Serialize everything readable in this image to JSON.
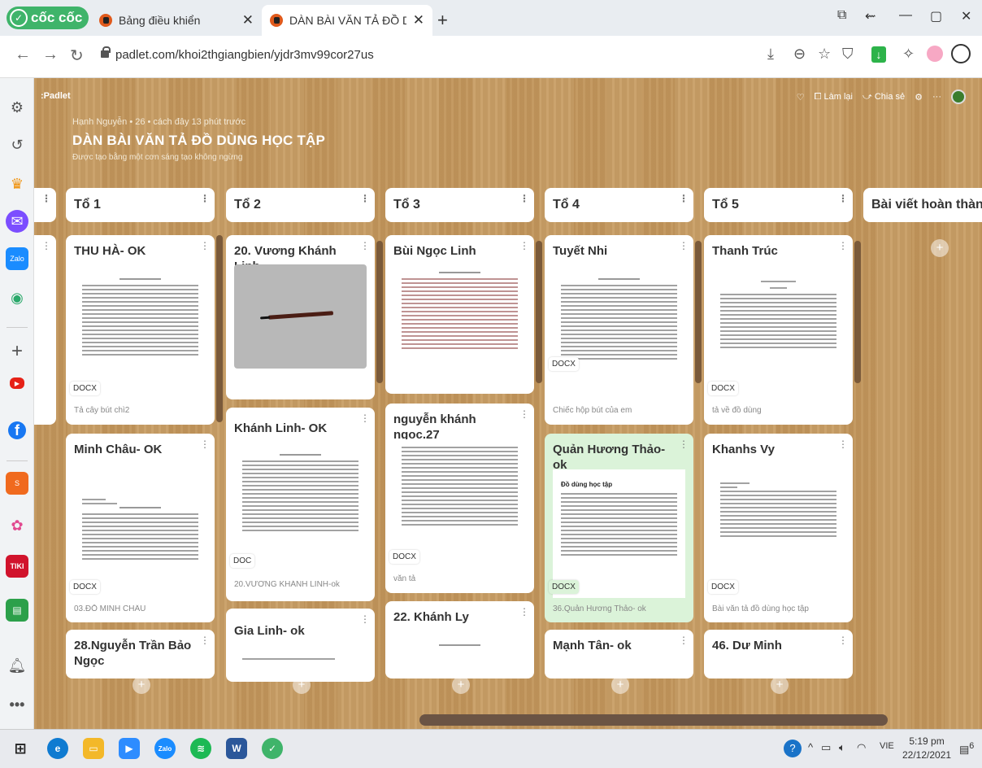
{
  "browser": {
    "brand": "cốc cốc",
    "tabs": [
      {
        "title": "Bảng điều khiển",
        "active": false
      },
      {
        "title": "DÀN BÀI VĂN TẢ ĐỒ DÙNG",
        "active": true
      }
    ],
    "url": "padlet.com/khoi2thgiangbien/yjdr3mv99cor27us"
  },
  "padlet": {
    "logo": "Padlet",
    "meta": "Hạnh Nguyễn • 26 • cách đây 13 phút trước",
    "title": "DÀN BÀI VĂN TẢ ĐỒ DÙNG HỌC TẬP",
    "subtitle": "Được tạo bằng một cơn sáng tạo không ngừng",
    "actions": {
      "remake": "Làm lại",
      "share": "Chia sẻ"
    },
    "columns": [
      {
        "title": "Tổ 1"
      },
      {
        "title": "Tổ 2"
      },
      {
        "title": "Tổ 3"
      },
      {
        "title": "Tổ 4"
      },
      {
        "title": "Tổ 5"
      },
      {
        "title": "Bài viết hoàn thành"
      }
    ],
    "cards": {
      "c1a": {
        "title": "THU HÀ- OK",
        "badge": "DOCX",
        "caption": "Tả cây bút chì2"
      },
      "c1b": {
        "title": "Minh Châu- OK",
        "badge": "DOCX",
        "caption": "03.ĐỖ MINH CHÂU"
      },
      "c1c": {
        "title": "28.Nguyễn Trần Bảo Ngọc"
      },
      "c2a": {
        "title": "20. Vương Khánh Linh"
      },
      "c2b": {
        "title": "Khánh Linh- OK",
        "badge": "DOC",
        "caption": "20.VƯƠNG KHÁNH LINH-ok"
      },
      "c2c": {
        "title": "Gia Linh- ok"
      },
      "c3a": {
        "title": "Bùi Ngọc Linh"
      },
      "c3b": {
        "title": "nguyễn khánh ngọc.27",
        "badge": "DOCX",
        "caption": "văn tả"
      },
      "c3c": {
        "title": "22. Khánh Ly"
      },
      "c4a": {
        "title": "Tuyết Nhi",
        "badge": "DOCX",
        "caption": "Chiếc hộp bút của em"
      },
      "c4b": {
        "title": "Quản Hương Thảo-ok",
        "badge": "DOCX",
        "caption": "36.Quản Hương Thảo- ok",
        "doc_heading": "Đồ dùng học tập"
      },
      "c4c": {
        "title": "Mạnh Tân- ok"
      },
      "c5a": {
        "title": "Thanh Trúc",
        "badge": "DOCX",
        "caption": "tả về đồ dùng"
      },
      "c5b": {
        "title": "Khanhs Vy",
        "badge": "DOCX",
        "caption": "Bài văn tả đồ dùng học tập"
      },
      "c5c": {
        "title": "46. Dư Minh"
      }
    }
  },
  "taskbar": {
    "lang": "VIE",
    "time": "5:19 pm",
    "date": "22/12/2021",
    "notifications": "6"
  }
}
